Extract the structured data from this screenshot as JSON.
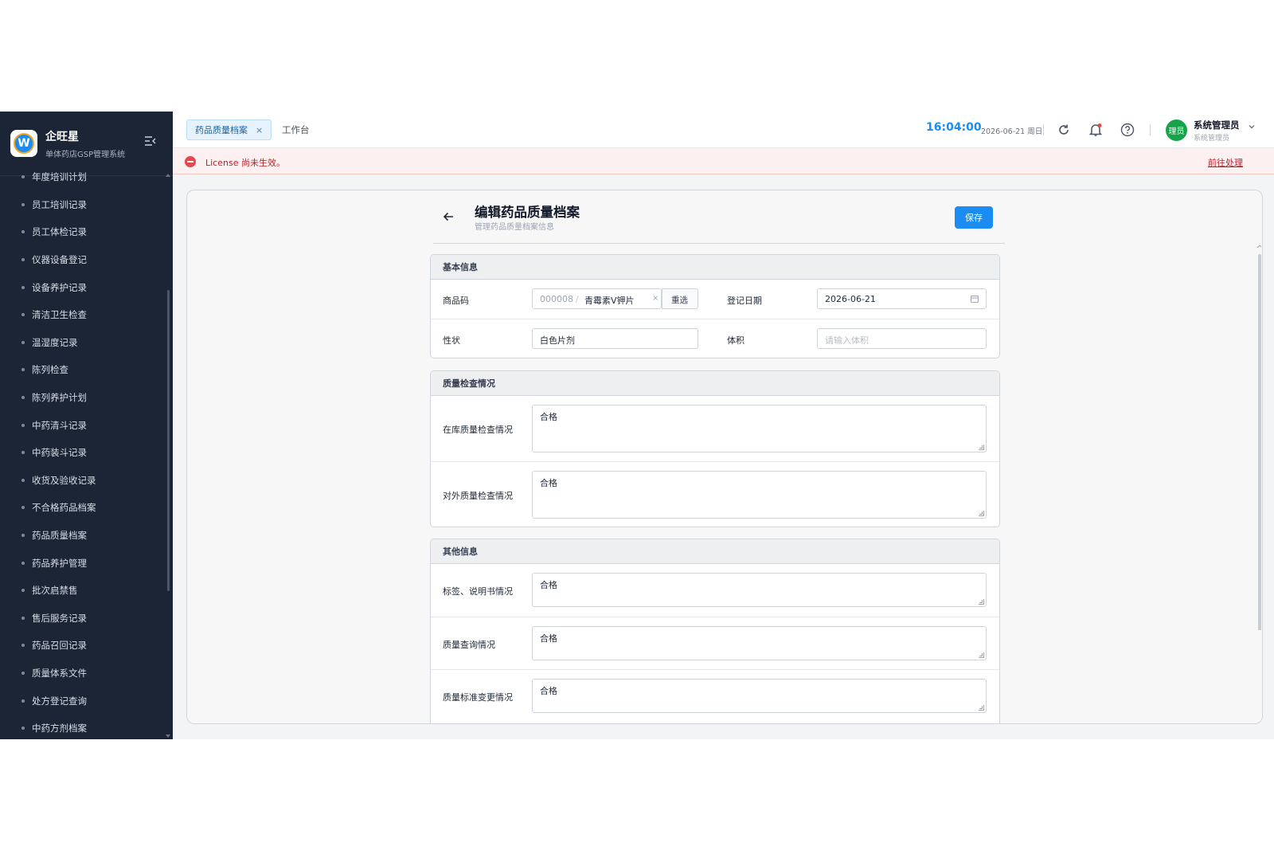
{
  "brand": {
    "name": "企旺星",
    "subtitle": "单体药店GSP管理系统",
    "logo_letter": "W"
  },
  "sidebar": {
    "items": [
      {
        "label": "年度培训计划"
      },
      {
        "label": "员工培训记录"
      },
      {
        "label": "员工体检记录"
      },
      {
        "label": "仪器设备登记"
      },
      {
        "label": "设备养护记录"
      },
      {
        "label": "清洁卫生检查"
      },
      {
        "label": "温湿度记录"
      },
      {
        "label": "陈列检查"
      },
      {
        "label": "陈列养护计划"
      },
      {
        "label": "中药清斗记录"
      },
      {
        "label": "中药装斗记录"
      },
      {
        "label": "收货及验收记录"
      },
      {
        "label": "不合格药品档案"
      },
      {
        "label": "药品质量档案"
      },
      {
        "label": "药品养护管理"
      },
      {
        "label": "批次启禁售"
      },
      {
        "label": "售后服务记录"
      },
      {
        "label": "药品召回记录"
      },
      {
        "label": "质量体系文件"
      },
      {
        "label": "处方登记查询"
      },
      {
        "label": "中药方剂档案"
      }
    ]
  },
  "tabs": {
    "active": "药品质量档案",
    "other": "工作台",
    "close": "×"
  },
  "header": {
    "clock": "16:04:00",
    "date": "2026-06-21 周日",
    "user_name": "系统管理员",
    "user_role": "系统管理员",
    "avatar_text": "理员"
  },
  "license": {
    "message": "License 尚未生效。",
    "link": "前往处理"
  },
  "page": {
    "title": "编辑药品质量档案",
    "subtitle": "管理药品质量档案信息",
    "save_label": "保存"
  },
  "basic": {
    "title": "基本信息",
    "product_code_label": "商品码",
    "product_code": "000008",
    "product_sep": "/",
    "product_name": "青霉素V钾片",
    "clear": "×",
    "reselect": "重选",
    "reg_date_label": "登记日期",
    "reg_date": "2026-06-21",
    "appearance_label": "性状",
    "appearance": "白色片剂",
    "volume_label": "体积",
    "volume_placeholder": "请输入体积"
  },
  "quality": {
    "title": "质量检查情况",
    "stock_label": "在库质量检查情况",
    "stock_value": "合格",
    "external_label": "对外质量检查情况",
    "external_value": "合格"
  },
  "other": {
    "title": "其他信息",
    "label_manual_label": "标签、说明书情况",
    "label_manual_value": "合格",
    "inquiry_label": "质量查询情况",
    "inquiry_value": "合格",
    "standard_label": "质量标准变更情况",
    "standard_value": "合格"
  },
  "colors": {
    "primary": "#1a8cf2",
    "sidebar_bg": "#1b2535",
    "danger": "#e5484d",
    "avatar": "#16a34a"
  }
}
